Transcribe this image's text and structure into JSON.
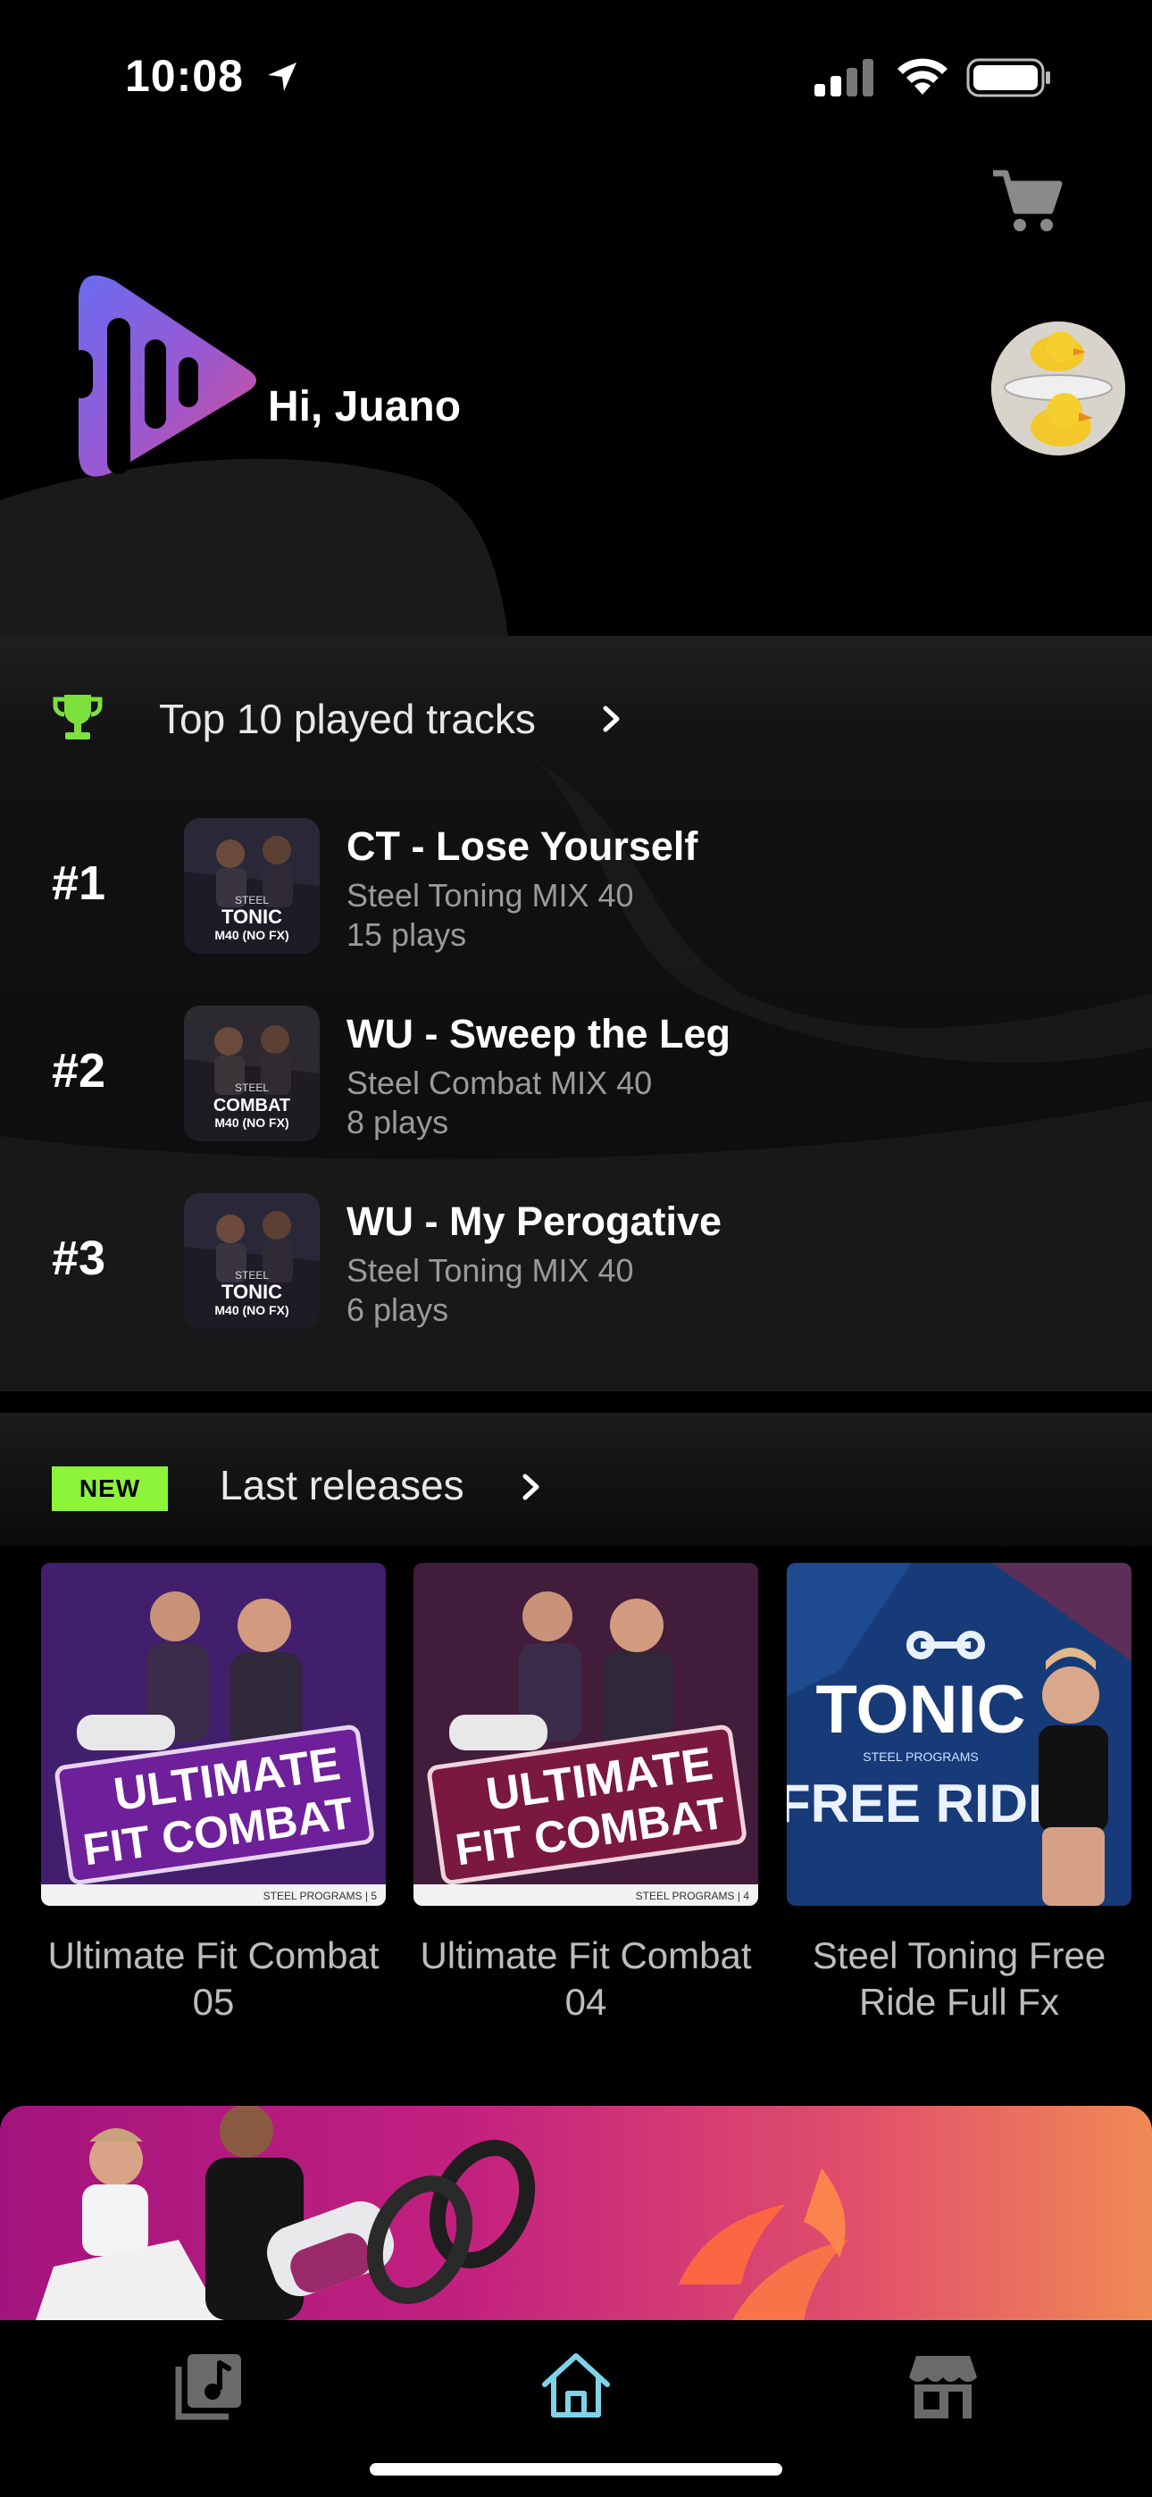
{
  "status_bar": {
    "time": "10:08"
  },
  "header": {
    "greeting": "Hi, Juano"
  },
  "top_tracks": {
    "title": "Top 10 played tracks",
    "items": [
      {
        "rank": "#1",
        "title": "CT - Lose Yourself",
        "mix": "Steel Toning MIX 40",
        "plays": "15 plays",
        "cover_brand": "STEEL",
        "cover_main": "TONIC",
        "cover_sub": "M40 (NO FX)"
      },
      {
        "rank": "#2",
        "title": "WU - Sweep the Leg",
        "mix": "Steel Combat MIX 40",
        "plays": "8 plays",
        "cover_brand": "STEEL",
        "cover_main": "COMBAT",
        "cover_sub": "M40 (NO FX)"
      },
      {
        "rank": "#3",
        "title": "WU - My Perogative",
        "mix": "Steel Toning MIX 40",
        "plays": "6 plays",
        "cover_brand": "STEEL",
        "cover_main": "TONIC",
        "cover_sub": "M40 (NO FX)"
      }
    ]
  },
  "releases": {
    "badge": "NEW",
    "title": "Last releases",
    "items": [
      {
        "name": "Ultimate Fit Combat 05",
        "cover_line1": "ULTIMATE",
        "cover_line2": "FIT COMBAT",
        "cover_footer": "STEEL PROGRAMS | 5",
        "cover_color": "#6e1f9a"
      },
      {
        "name": "Ultimate Fit Combat 04",
        "cover_line1": "ULTIMATE",
        "cover_line2": "FIT COMBAT",
        "cover_footer": "STEEL PROGRAMS | 4",
        "cover_color": "#7a1840"
      },
      {
        "name": "Steel Toning Free Ride Full Fx",
        "cover_line1": "TONIC",
        "cover_line2": "FREE RIDE",
        "cover_footer": "STEEL PROGRAMS",
        "cover_color": "#173a78"
      }
    ]
  },
  "tabs": [
    {
      "icon": "music-library-icon",
      "active": false
    },
    {
      "icon": "home-icon",
      "active": true
    },
    {
      "icon": "store-icon",
      "active": false
    }
  ],
  "colors": {
    "accent_green": "#8cf53a",
    "active_tab": "#7fd3e8",
    "inactive_tab": "#6a6a6a"
  }
}
